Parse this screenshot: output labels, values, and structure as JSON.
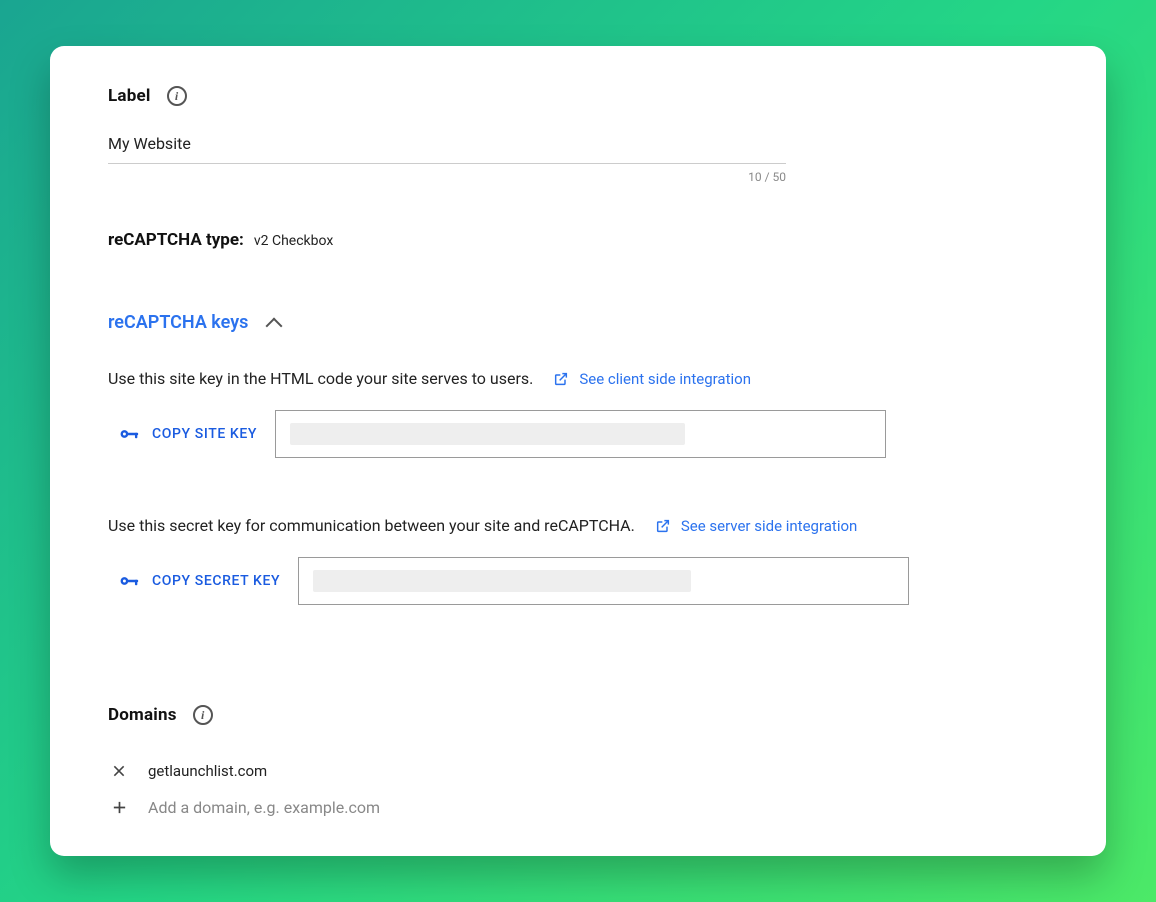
{
  "label": {
    "title": "Label",
    "value": "My Website",
    "char_count": "10 / 50"
  },
  "type": {
    "label": "reCAPTCHA type:",
    "value": "v2 Checkbox"
  },
  "keys": {
    "title": "reCAPTCHA keys",
    "site": {
      "desc": "Use this site key in the HTML code your site serves to users.",
      "link": "See client side integration",
      "copy": "COPY SITE KEY"
    },
    "secret": {
      "desc": "Use this secret key for communication between your site and reCAPTCHA.",
      "link": "See server side integration",
      "copy": "COPY SECRET KEY"
    }
  },
  "domains": {
    "title": "Domains",
    "items": [
      "getlaunchlist.com"
    ],
    "add_placeholder": "Add a domain, e.g. example.com"
  }
}
